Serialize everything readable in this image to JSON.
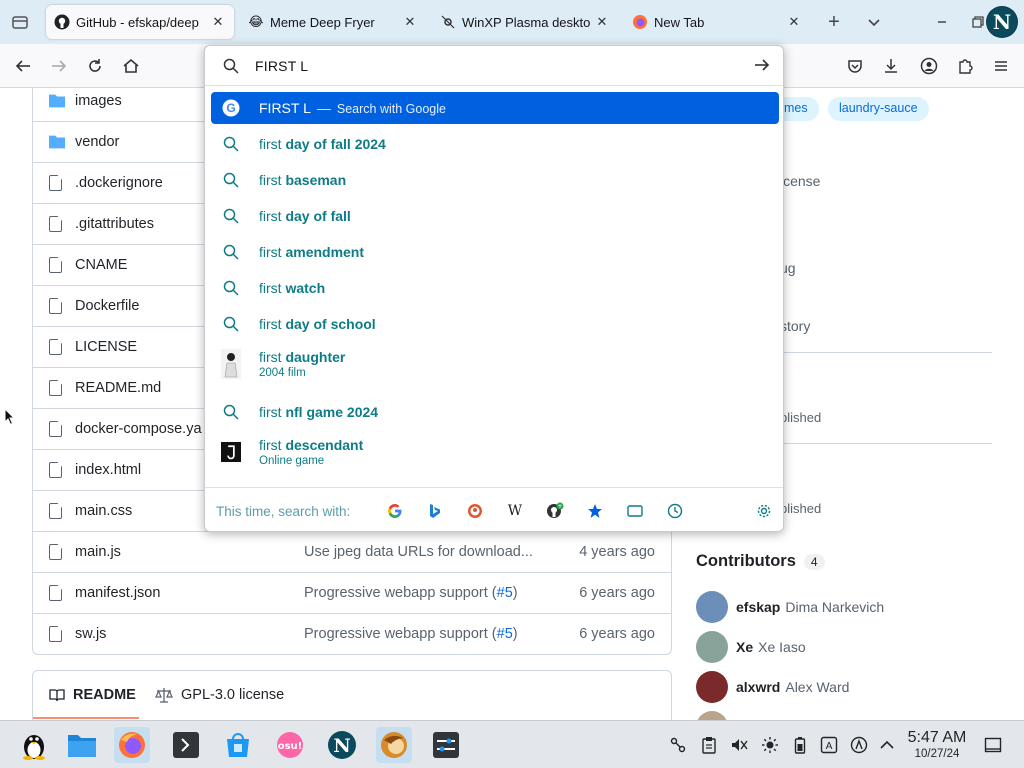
{
  "tabs": [
    {
      "title": "GitHub - efskap/deep",
      "icon": "github-icon",
      "active": true
    },
    {
      "title": "Meme Deep Fryer",
      "icon": "emoji-icon",
      "active": false
    },
    {
      "title": "WinXP Plasma deskto",
      "icon": "plasma-icon",
      "active": false
    },
    {
      "title": "New Tab",
      "icon": "firefox-icon",
      "active": false
    }
  ],
  "urlbar": {
    "value": "FIRST L",
    "suggestions": [
      {
        "type": "search-engine",
        "text": "FIRST L",
        "dash": "—",
        "hint": "Search with Google",
        "selected": true
      },
      {
        "type": "search",
        "prefix": "first",
        "rest": "day of fall 2024"
      },
      {
        "type": "search",
        "prefix": "first",
        "rest": "baseman"
      },
      {
        "type": "search",
        "prefix": "first",
        "rest": "day of fall"
      },
      {
        "type": "search",
        "prefix": "first",
        "rest": "amendment"
      },
      {
        "type": "search",
        "prefix": "first",
        "rest": "watch"
      },
      {
        "type": "search",
        "prefix": "first",
        "rest": "day of school"
      },
      {
        "type": "rich",
        "prefix": "first",
        "rest": "daughter",
        "sub": "2004 film"
      },
      {
        "type": "search",
        "prefix": "first",
        "rest": "nfl game 2024"
      },
      {
        "type": "rich",
        "prefix": "first",
        "rest": "descendant",
        "sub": "Online game"
      }
    ],
    "search_with_label": "This time, search with:",
    "engines": [
      "google-icon",
      "bing-icon",
      "duckduckgo-icon",
      "wikipedia-icon",
      "github-icon",
      "bookmarks-icon",
      "tabs-icon",
      "history-icon"
    ]
  },
  "files": [
    {
      "name": "images",
      "kind": "folder",
      "msg": "",
      "when": ""
    },
    {
      "name": "vendor",
      "kind": "folder",
      "msg": "",
      "when": ""
    },
    {
      "name": ".dockerignore",
      "kind": "file",
      "msg": "",
      "when": ""
    },
    {
      "name": ".gitattributes",
      "kind": "file",
      "msg": "",
      "when": ""
    },
    {
      "name": "CNAME",
      "kind": "file",
      "msg": "",
      "when": ""
    },
    {
      "name": "Dockerfile",
      "kind": "file",
      "msg": "",
      "when": ""
    },
    {
      "name": "LICENSE",
      "kind": "file",
      "msg": "",
      "when": ""
    },
    {
      "name": "README.md",
      "kind": "file",
      "msg": "",
      "when": ""
    },
    {
      "name": "docker-compose.ya",
      "kind": "file",
      "msg": "",
      "when": ""
    },
    {
      "name": "index.html",
      "kind": "file",
      "msg": "",
      "when": ""
    },
    {
      "name": "main.css",
      "kind": "file",
      "msg": "",
      "when": ""
    },
    {
      "name": "main.js",
      "kind": "file",
      "msg": "Use jpeg data URLs for download...",
      "when": "4 years ago"
    },
    {
      "name": "manifest.json",
      "kind": "file",
      "msg": "Progressive webapp support (",
      "msg_link": "#5",
      "msg_end": ")",
      "when": "6 years ago"
    },
    {
      "name": "sw.js",
      "kind": "file",
      "msg": "Progressive webapp support (",
      "msg_link": "#5",
      "msg_end": ")",
      "when": "6 years ago"
    }
  ],
  "readme": {
    "tab1": "README",
    "tab2": "GPL-3.0 license"
  },
  "sidebar": {
    "topics": [
      "emes",
      "laundry-sauce"
    ],
    "fragments": [
      "icense",
      "ug",
      "story",
      "blished",
      "blished"
    ],
    "contributors_title": "Contributors",
    "contributors_count": "4",
    "contributors": [
      {
        "login": "efskap",
        "name": "Dima Narkevich",
        "color": "#6b8fb8"
      },
      {
        "login": "Xe",
        "name": "Xe Iaso",
        "color": "#8aa39a"
      },
      {
        "login": "alxwrd",
        "name": "Alex Ward",
        "color": "#7a2a2a"
      },
      {
        "login": "",
        "name": "",
        "color": "#b8a58c"
      }
    ]
  },
  "taskbar": {
    "apps": [
      "tux-icon",
      "file-manager-icon",
      "firefox-icon",
      "terminal-icon",
      "store-icon",
      "osu-icon",
      "netscape-icon",
      "thunderbird-icon",
      "mixer-icon"
    ],
    "time": "5:47 AM",
    "date": "10/27/24"
  }
}
